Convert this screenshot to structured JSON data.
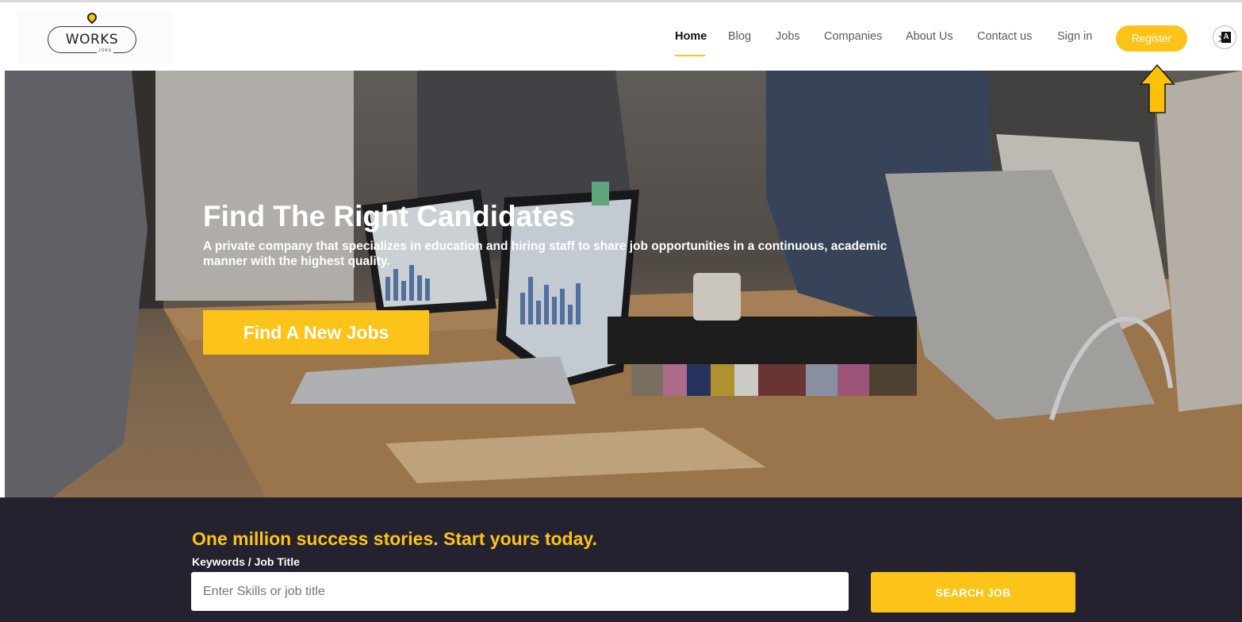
{
  "header": {
    "logo_text": "WORKS",
    "logo_sub": "JOBS",
    "nav": [
      {
        "label": "Home",
        "active": true
      },
      {
        "label": "Blog"
      },
      {
        "label": "Jobs"
      },
      {
        "label": "Companies"
      },
      {
        "label": "About Us"
      },
      {
        "label": "Contact us"
      },
      {
        "label": "Sign in"
      }
    ],
    "register_label": "Register",
    "language_icon": "translate-icon"
  },
  "hero": {
    "title": "Find The Right Candidates",
    "subtitle": "A private company that specializes in education and hiring staff to share job opportunities in a continuous, academic manner with the highest quality.",
    "cta_label": "Find A New Jobs"
  },
  "search": {
    "heading": "One million success stories. Start yours today.",
    "field_label": "Keywords / Job Title",
    "placeholder": "Enter Skills or job title",
    "value": "",
    "button_label": "SEARCH JOB"
  },
  "colors": {
    "accent": "#fcc318",
    "band_background": "#24222f",
    "annotation_arrow": "#ffc107"
  }
}
